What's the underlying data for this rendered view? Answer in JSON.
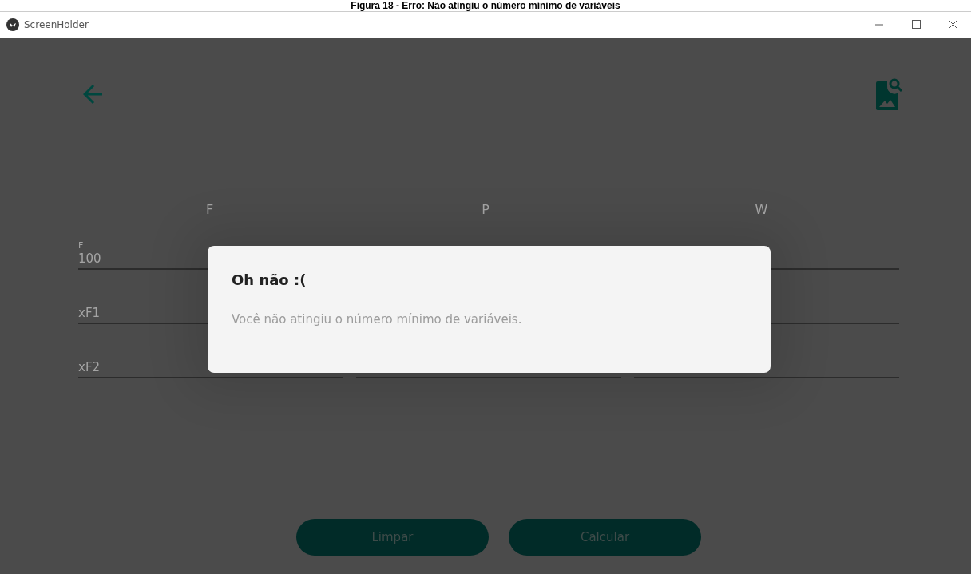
{
  "caption": "Figura 18 - Erro: Não atingiu o número mínimo de variáveis",
  "window": {
    "title": "ScreenHolder"
  },
  "columns": [
    "F",
    "P",
    "W"
  ],
  "fields": [
    {
      "label": "F",
      "value": "100"
    },
    {
      "placeholder": "xF1"
    },
    {
      "placeholder": "xF2"
    }
  ],
  "dialog": {
    "title": "Oh não :(",
    "message": "Você não atingiu o número mínimo de variáveis."
  },
  "buttons": [
    "Limpar",
    "Calcular"
  ]
}
